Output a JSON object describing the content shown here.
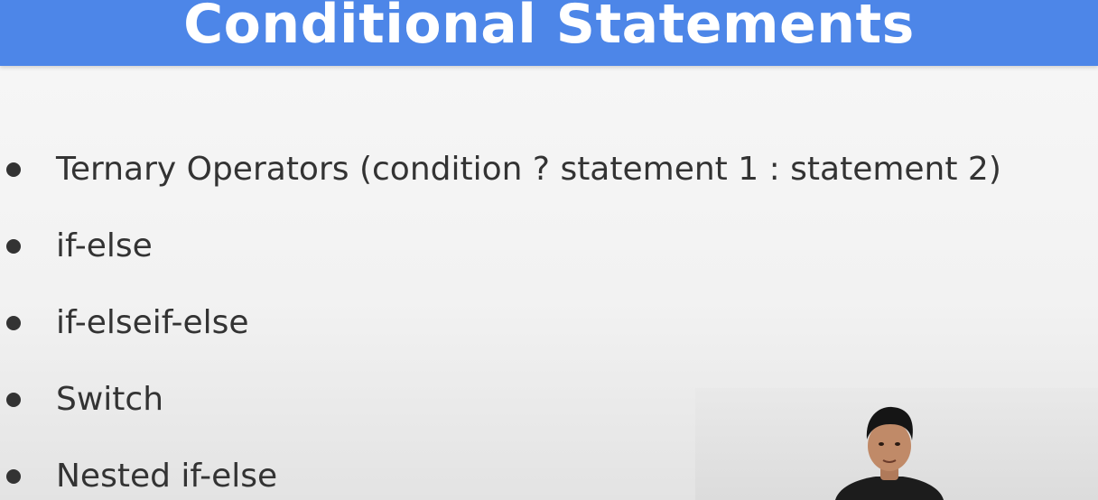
{
  "slide": {
    "title": "Conditional Statements",
    "bullets": [
      "Ternary Operators (condition ? statement 1 : statement 2)",
      "if-else",
      "if-elseif-else",
      "Switch",
      "Nested if-else"
    ]
  },
  "colors": {
    "title_bar": "#4d86e8",
    "title_text": "#ffffff",
    "body_text": "#333333",
    "background": "#f2f2f2"
  },
  "icons": {
    "bullet": "bullet-dot-icon",
    "presenter": "presenter-video-thumbnail"
  }
}
